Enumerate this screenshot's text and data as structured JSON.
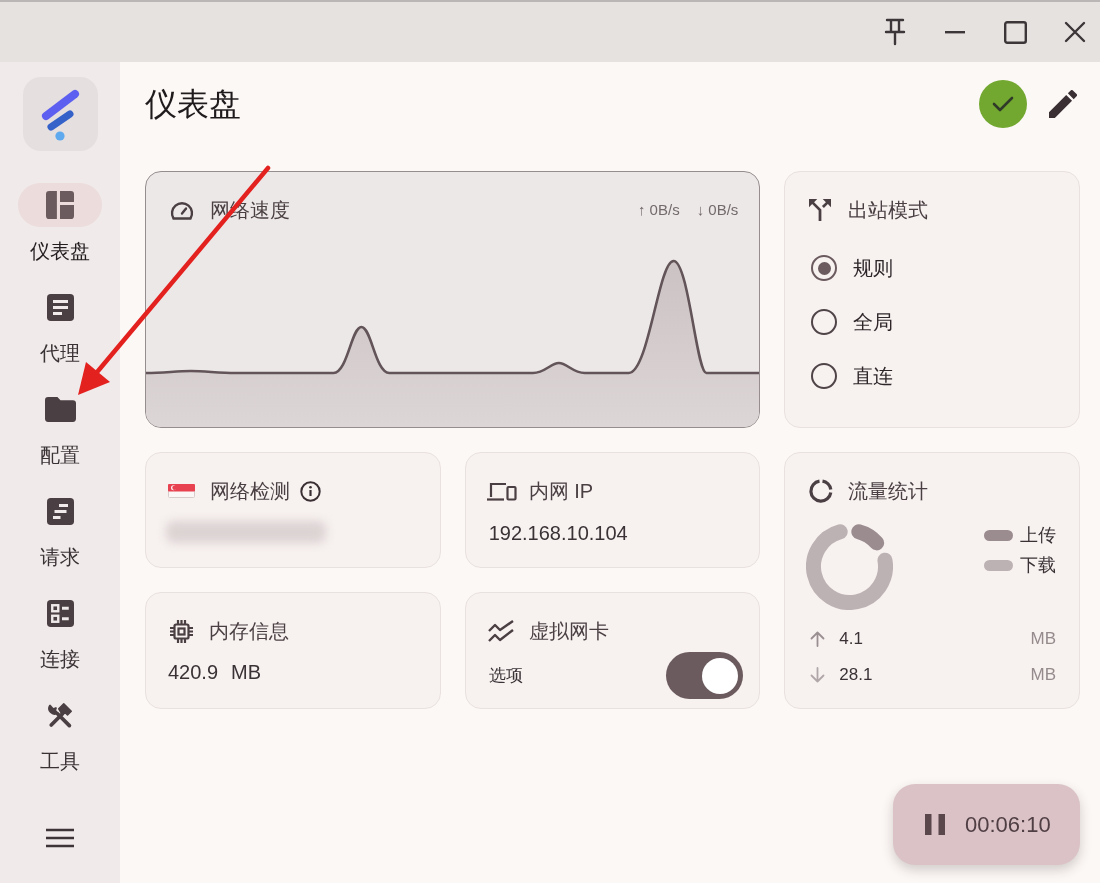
{
  "sidebar": {
    "items": [
      {
        "label": "仪表盘",
        "selected": true
      },
      {
        "label": "代理",
        "selected": false
      },
      {
        "label": "配置",
        "selected": false
      },
      {
        "label": "请求",
        "selected": false
      },
      {
        "label": "连接",
        "selected": false
      },
      {
        "label": "工具",
        "selected": false
      }
    ]
  },
  "header": {
    "title": "仪表盘"
  },
  "network_speed": {
    "title": "网络速度",
    "upload": "↑ 0B/s",
    "download": "↓ 0B/s"
  },
  "outbound_mode": {
    "title": "出站模式",
    "options": [
      {
        "label": "规则",
        "selected": true
      },
      {
        "label": "全局",
        "selected": false
      },
      {
        "label": "直连",
        "selected": false
      }
    ]
  },
  "network_check": {
    "title": "网络检测"
  },
  "lan_ip": {
    "title": "内网 IP",
    "value": "192.168.10.104"
  },
  "traffic": {
    "title": "流量统计",
    "legend": [
      {
        "label": "上传",
        "color": "#9b8c90"
      },
      {
        "label": "下载",
        "color": "#bdb2b3"
      }
    ],
    "rows": [
      {
        "value": "4.1",
        "unit": "MB"
      },
      {
        "value": "28.1",
        "unit": "MB"
      }
    ]
  },
  "memory": {
    "title": "内存信息",
    "value": "420.9",
    "unit": "MB"
  },
  "virtual_nic": {
    "title": "虚拟网卡",
    "option_label": "选项",
    "on": true
  },
  "timer": {
    "time": "00:06:10"
  }
}
